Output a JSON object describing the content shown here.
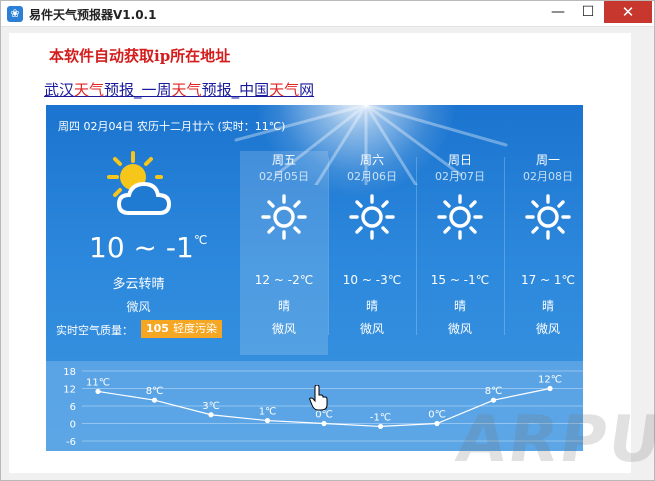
{
  "window": {
    "title": "易件天气预报器V1.0.1",
    "minimize_glyph": "—",
    "maximize_glyph": "☐",
    "close_glyph": "✕"
  },
  "notice": "本软件自动获取ip所在地址",
  "link": {
    "parts": [
      {
        "text": "武汉",
        "red": false
      },
      {
        "text": "天气",
        "red": true
      },
      {
        "text": "预报_一周",
        "red": false
      },
      {
        "text": "天气",
        "red": true
      },
      {
        "text": "预报_中国",
        "red": false
      },
      {
        "text": "天气",
        "red": true
      },
      {
        "text": "网",
        "red": false
      }
    ]
  },
  "today": {
    "header": "周四 02月04日 农历十二月廿六 (实时：11℃)",
    "icon": "partly-cloudy-icon",
    "temp": "10 ~ -1",
    "temp_unit": "℃",
    "desc": "多云转晴",
    "wind": "微风",
    "aqi_label": "实时空气质量：",
    "aqi_value": "105",
    "aqi_level": "轻度污染",
    "aqi_color": "#f5a623"
  },
  "forecast": [
    {
      "name": "周五",
      "date": "02月05日",
      "temp": "12 ~ -2℃",
      "desc": "晴",
      "wind": "微风",
      "icon": "sun-icon",
      "selected": true
    },
    {
      "name": "周六",
      "date": "02月06日",
      "temp": "10 ~ -3℃",
      "desc": "晴",
      "wind": "微风",
      "icon": "sun-icon",
      "selected": false
    },
    {
      "name": "周日",
      "date": "02月07日",
      "temp": "15 ~ -1℃",
      "desc": "晴",
      "wind": "微风",
      "icon": "sun-icon",
      "selected": false
    },
    {
      "name": "周一",
      "date": "02月08日",
      "temp": "17 ~ 1℃",
      "desc": "晴",
      "wind": "微风",
      "icon": "sun-icon",
      "selected": false
    }
  ],
  "chart_data": {
    "type": "line",
    "y_ticks": [
      18,
      12,
      6,
      0,
      -6
    ],
    "ylim": [
      -6,
      18
    ],
    "grid": true,
    "series": [
      {
        "values": [
          11,
          8,
          3,
          1,
          0,
          -1,
          0,
          8,
          12
        ],
        "labels": [
          "11℃",
          "8℃",
          "3℃",
          "1℃",
          "0℃",
          "-1℃",
          "0℃",
          "8℃",
          "12℃"
        ]
      }
    ]
  },
  "watermark": "ARPUN",
  "colors": {
    "panel_top": "#1b74cf",
    "panel_bottom": "#3b95e0",
    "notice": "#d31c1c",
    "link": "#1a1a9c",
    "link_highlight": "#e02424",
    "close_button": "#c7372e"
  }
}
